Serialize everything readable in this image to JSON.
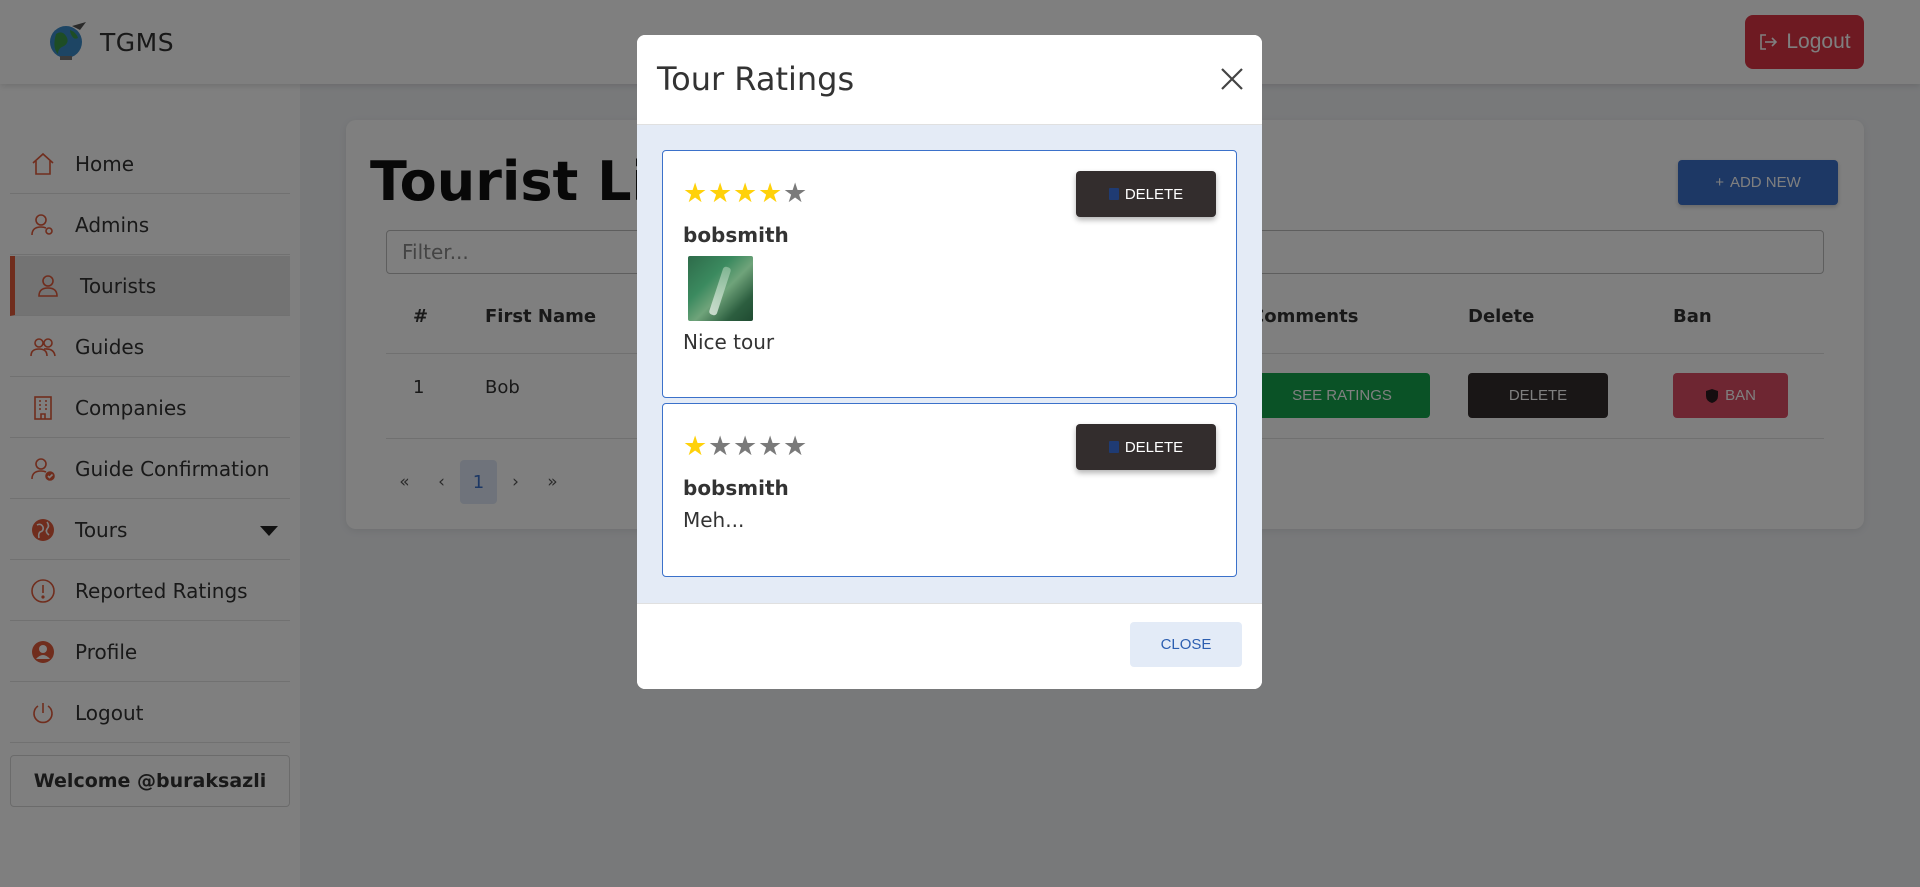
{
  "app": {
    "name": "TGMS",
    "logout_label": "Logout"
  },
  "sidebar": {
    "items": [
      {
        "label": "Home",
        "icon": "home-icon"
      },
      {
        "label": "Admins",
        "icon": "admin-icon"
      },
      {
        "label": "Tourists",
        "icon": "user-icon"
      },
      {
        "label": "Guides",
        "icon": "users-icon"
      },
      {
        "label": "Companies",
        "icon": "building-icon"
      },
      {
        "label": "Guide Confirmation",
        "icon": "user-check-icon"
      },
      {
        "label": "Tours",
        "icon": "globe-icon"
      },
      {
        "label": "Reported Ratings",
        "icon": "exclamation-icon"
      },
      {
        "label": "Profile",
        "icon": "profile-icon"
      },
      {
        "label": "Logout",
        "icon": "power-icon"
      }
    ],
    "welcome": "Welcome @buraksazli"
  },
  "main": {
    "title": "Tourist List",
    "add_new_label": "ADD NEW",
    "filter_placeholder": "Filter...",
    "table": {
      "headers": [
        "#",
        "First Name",
        "Comments",
        "Delete",
        "Ban"
      ],
      "rows": [
        {
          "num": "1",
          "first_name": "Bob",
          "see_ratings": "SEE RATINGS",
          "delete": "DELETE",
          "ban": "BAN"
        }
      ]
    },
    "pagination": {
      "first": "«",
      "prev": "‹",
      "current": "1",
      "next": "›",
      "last": "»"
    }
  },
  "modal": {
    "title": "Tour Ratings",
    "ratings": [
      {
        "stars": 4,
        "max": 5,
        "username": "bobsmith",
        "comment": "Nice tour",
        "has_image": true,
        "delete_label": "DELETE"
      },
      {
        "stars": 1,
        "max": 5,
        "username": "bobsmith",
        "comment": "Meh...",
        "has_image": false,
        "delete_label": "DELETE"
      }
    ],
    "close_label": "CLOSE"
  },
  "colors": {
    "accent": "#e05a3a",
    "logout": "#dc3545",
    "primary": "#3b71ca",
    "success": "#14a44d",
    "dark": "#332d2d",
    "danger": "#dc4c64",
    "star_on": "#ffd10a",
    "star_off": "#7a7a7a"
  }
}
